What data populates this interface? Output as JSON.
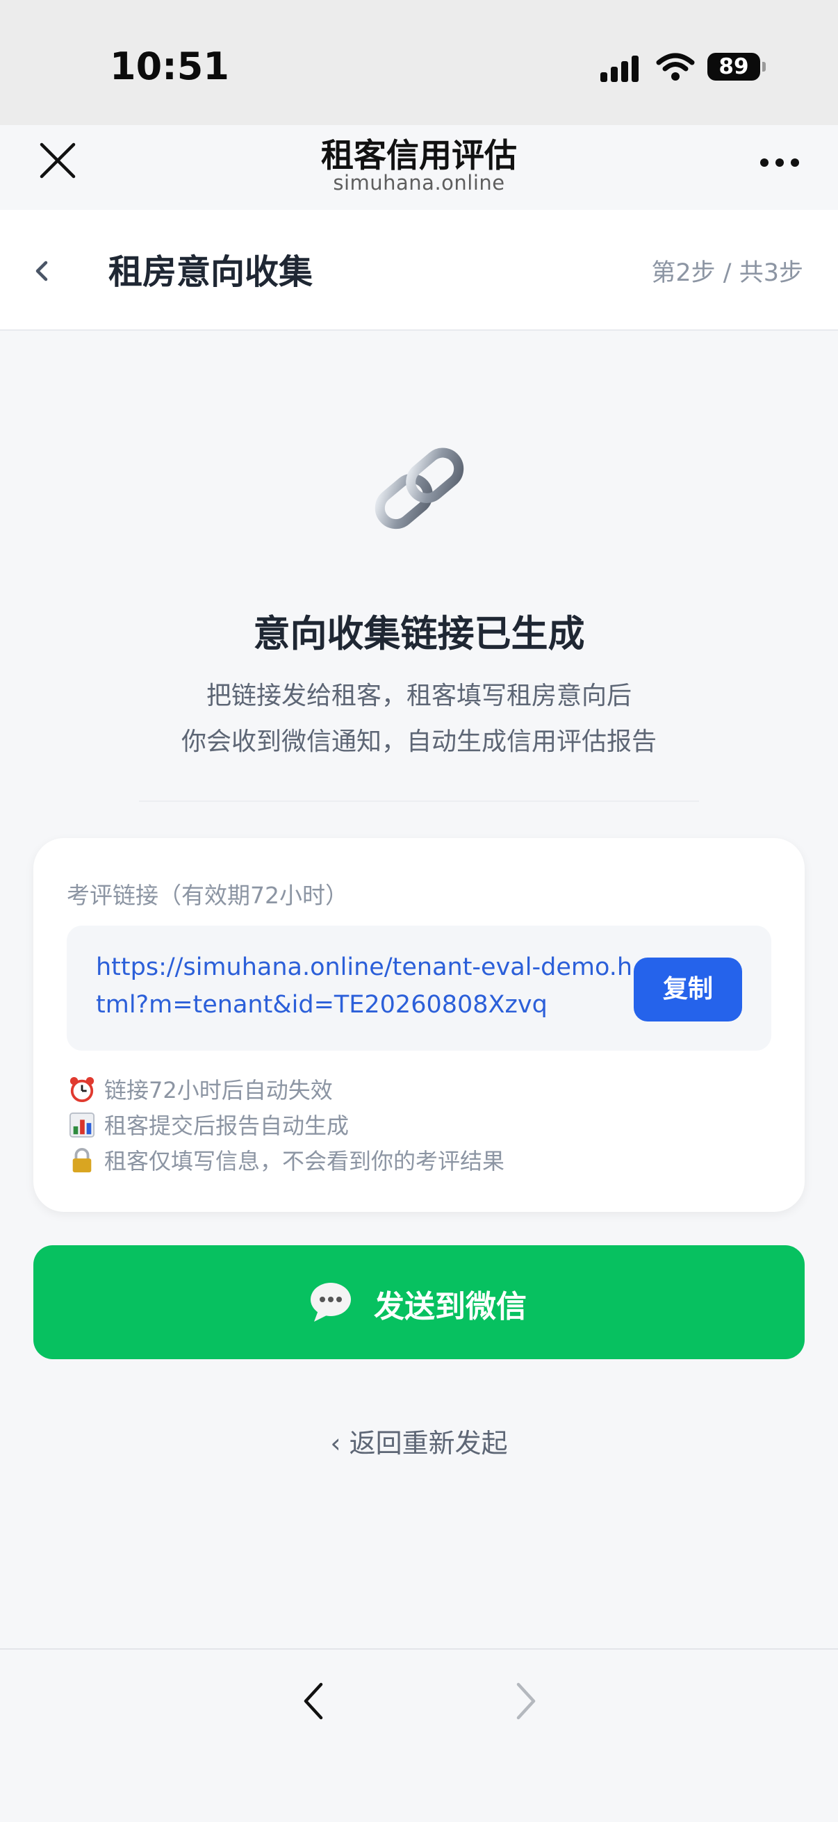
{
  "status_bar": {
    "time": "10:51",
    "battery": "89"
  },
  "nav": {
    "title": "租客信用评估",
    "subtitle": "simuhana.online"
  },
  "header": {
    "title": "租房意向收集",
    "step": "第2步 / 共3步"
  },
  "hero": {
    "icon": "chain-link-icon",
    "title": "意向收集链接已生成",
    "desc_line1": "把链接发给租客，租客填写租房意向后",
    "desc_line2": "你会收到微信通知，自动生成信用评估报告"
  },
  "link_card": {
    "label": "考评链接（有效期72小时）",
    "url_line1": "https://simuhana.online/tenant-eval-demo.h",
    "url_line2": "tml?m=tenant&id=TE20260808Xzvq",
    "copy_label": "复制",
    "notes": [
      {
        "icon": "alarm-clock-icon",
        "text": "链接72小时后自动失效"
      },
      {
        "icon": "bar-chart-icon",
        "text": "租客提交后报告自动生成"
      },
      {
        "icon": "lock-icon",
        "text": "租客仅填写信息，不会看到你的考评结果"
      }
    ]
  },
  "actions": {
    "wechat_label": "发送到微信",
    "restart_label": "‹ 返回重新发起"
  },
  "colors": {
    "primary_blue": "#2563eb",
    "wechat_green": "#07c160",
    "link_blue": "#2b5fd9"
  }
}
